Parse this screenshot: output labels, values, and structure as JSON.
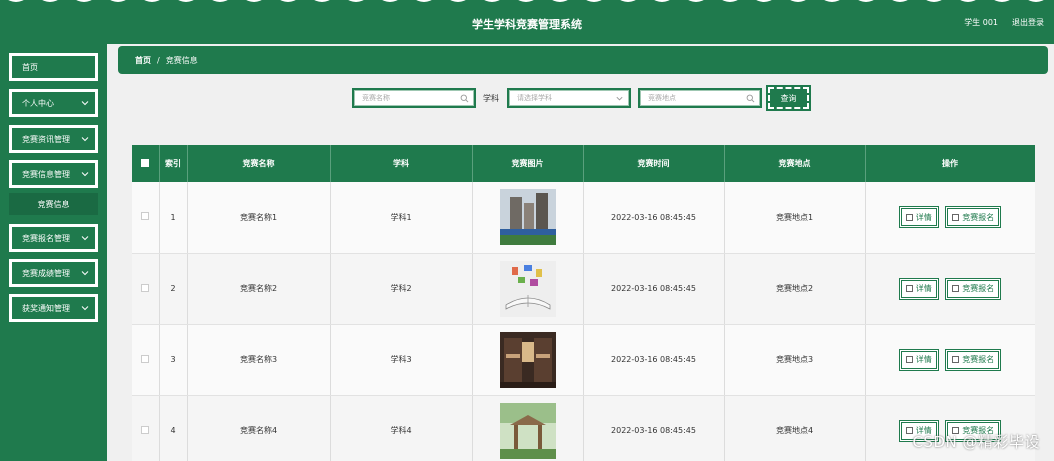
{
  "header": {
    "title": "学生学科竞赛管理系统",
    "user": "学生 001",
    "logout": "退出登录"
  },
  "sidebar": {
    "items": [
      {
        "label": "首页"
      },
      {
        "label": "个人中心"
      },
      {
        "label": "竞赛资讯管理"
      },
      {
        "label": "竞赛信息管理"
      },
      {
        "label": "竞赛报名管理"
      },
      {
        "label": "竞赛成绩管理"
      },
      {
        "label": "获奖通知管理"
      }
    ],
    "sub_item": "竞赛信息"
  },
  "breadcrumb": {
    "home": "首页",
    "separator": "/",
    "current": "竞赛信息"
  },
  "search": {
    "name_placeholder": "竞赛名称",
    "subject_label": "学科",
    "subject_placeholder": "请选择学科",
    "location_placeholder": "竞赛地点",
    "query_button": "查询"
  },
  "table": {
    "headers": [
      "索引",
      "竞赛名称",
      "学科",
      "竞赛图片",
      "竞赛时间",
      "竞赛地点",
      "操作"
    ],
    "rows": [
      {
        "index": "1",
        "name": "竞赛名称1",
        "subject": "学科1",
        "time": "2022-03-16 08:45:45",
        "location": "竞赛地点1",
        "image": "building-photo"
      },
      {
        "index": "2",
        "name": "竞赛名称2",
        "subject": "学科2",
        "time": "2022-03-16 08:45:45",
        "location": "竞赛地点2",
        "image": "book-illustration"
      },
      {
        "index": "3",
        "name": "竞赛名称3",
        "subject": "学科3",
        "time": "2022-03-16 08:45:45",
        "location": "竞赛地点3",
        "image": "dorm-room-photo"
      },
      {
        "index": "4",
        "name": "竞赛名称4",
        "subject": "学科4",
        "time": "2022-03-16 08:45:45",
        "location": "竞赛地点4",
        "image": "pavilion-photo"
      }
    ],
    "detail_button": "详情",
    "signup_button": "竞赛报名"
  },
  "watermark": "CSDN @精彩毕设",
  "colors": {
    "primary": "#1f7a4d",
    "background": "#f0f0f0"
  }
}
